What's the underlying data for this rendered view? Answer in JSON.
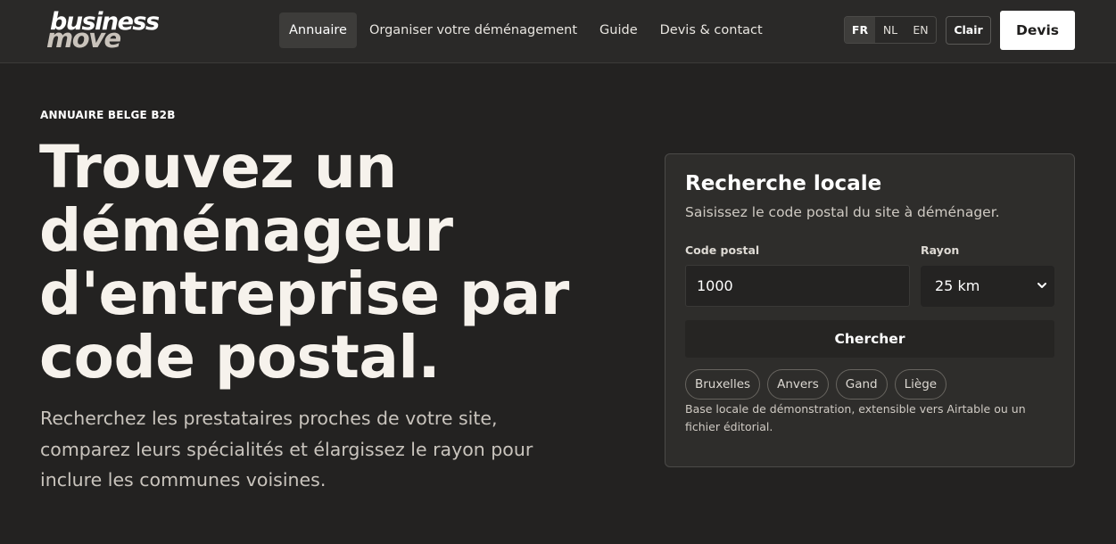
{
  "brand": {
    "line1": "business",
    "line2": "move"
  },
  "nav": [
    {
      "label": "Annuaire",
      "active": true
    },
    {
      "label": "Organiser votre déménagement",
      "active": false
    },
    {
      "label": "Guide",
      "active": false
    },
    {
      "label": "Devis & contact",
      "active": false
    }
  ],
  "languages": [
    {
      "label": "FR",
      "active": true
    },
    {
      "label": "NL",
      "active": false
    },
    {
      "label": "EN",
      "active": false
    }
  ],
  "theme_toggle": "Clair",
  "quote_button": "Devis",
  "hero": {
    "eyebrow": "ANNUAIRE BELGE B2B",
    "title": "Trouvez un déménageur d'entreprise par code postal.",
    "subtitle": "Recherchez les prestataires proches de votre site, comparez leurs spécialités et élargissez le rayon pour inclure les communes voisines."
  },
  "search": {
    "title": "Recherche locale",
    "subtitle": "Saisissez le code postal du site à déménager.",
    "postal_label": "Code postal",
    "postal_value": "1000",
    "radius_label": "Rayon",
    "radius_value": "25 km",
    "submit_label": "Chercher",
    "quick_cities": [
      "Bruxelles",
      "Anvers",
      "Gand",
      "Liège"
    ],
    "note": "Base locale de démonstration, extensible vers Airtable ou un fichier éditorial."
  },
  "colors": {
    "background": "#232221",
    "header": "#2a2928",
    "card": "#2e2d2b",
    "accent": "#ffffff"
  }
}
